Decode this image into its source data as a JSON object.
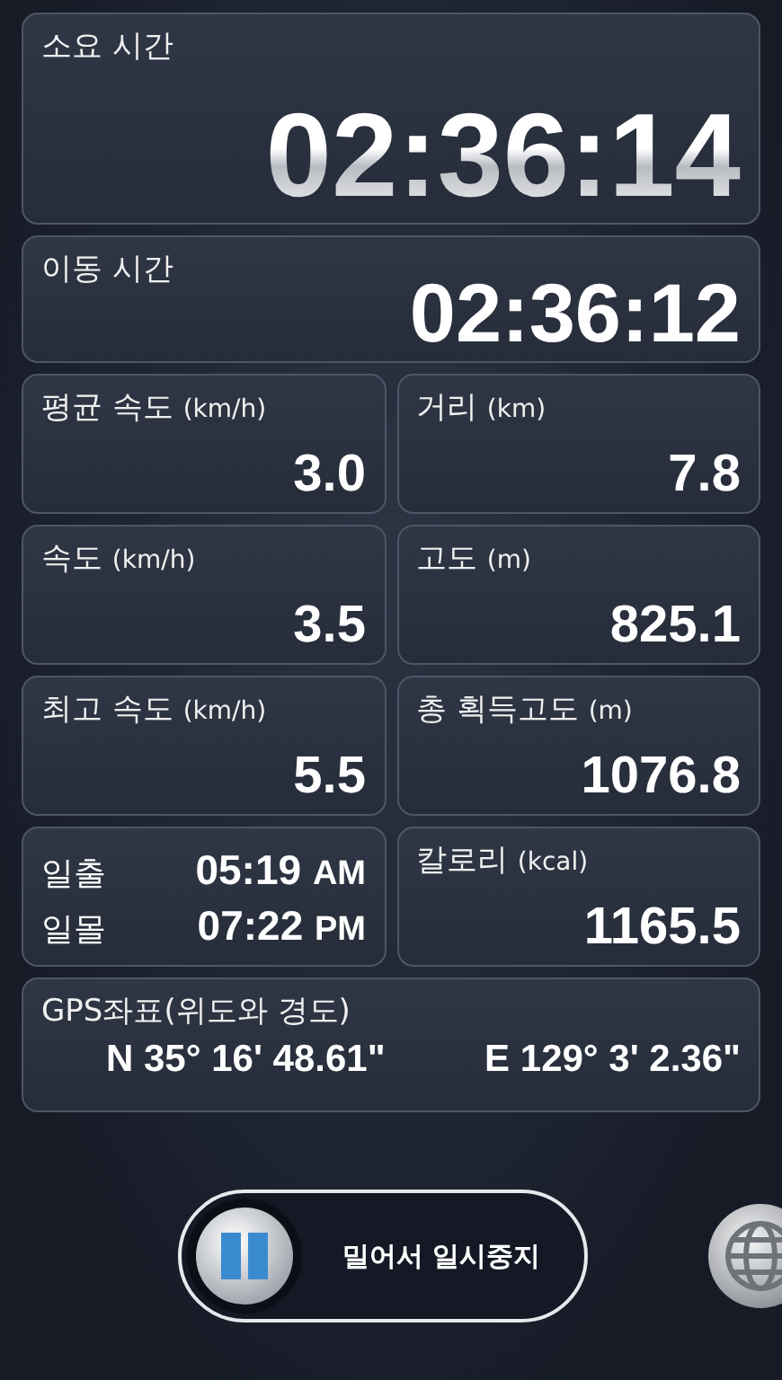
{
  "total_time": {
    "label": "소요 시간",
    "value": "02:36:14"
  },
  "moving_time": {
    "label": "이동 시간",
    "value": "02:36:12"
  },
  "cells": [
    {
      "kind": "stat",
      "label": "평균 속도",
      "unit": "(km/h)",
      "value": "3.0"
    },
    {
      "kind": "stat",
      "label": "거리",
      "unit": "(km)",
      "value": "7.8"
    },
    {
      "kind": "stat",
      "label": "속도",
      "unit": "(km/h)",
      "value": "3.5"
    },
    {
      "kind": "stat",
      "label": "고도",
      "unit": "(m)",
      "value": "825.1"
    },
    {
      "kind": "stat",
      "label": "최고 속도",
      "unit": "(km/h)",
      "value": "5.5"
    },
    {
      "kind": "stat",
      "label": "총 획득고도",
      "unit": "(m)",
      "value": "1076.8"
    },
    {
      "kind": "sun",
      "rows": [
        {
          "label": "일출",
          "time": "05:19",
          "period": "AM"
        },
        {
          "label": "일몰",
          "time": "07:22",
          "period": "PM"
        }
      ]
    },
    {
      "kind": "stat",
      "label": "칼로리",
      "unit": "(kcal)",
      "value": "1165.5"
    }
  ],
  "gps": {
    "label": "GPS좌표(위도와 경도)",
    "latitude": "N 35° 16' 48.61\"",
    "longitude": "E 129° 3' 2.36\""
  },
  "slider": {
    "label": "밀어서 일시중지",
    "level": 0
  }
}
